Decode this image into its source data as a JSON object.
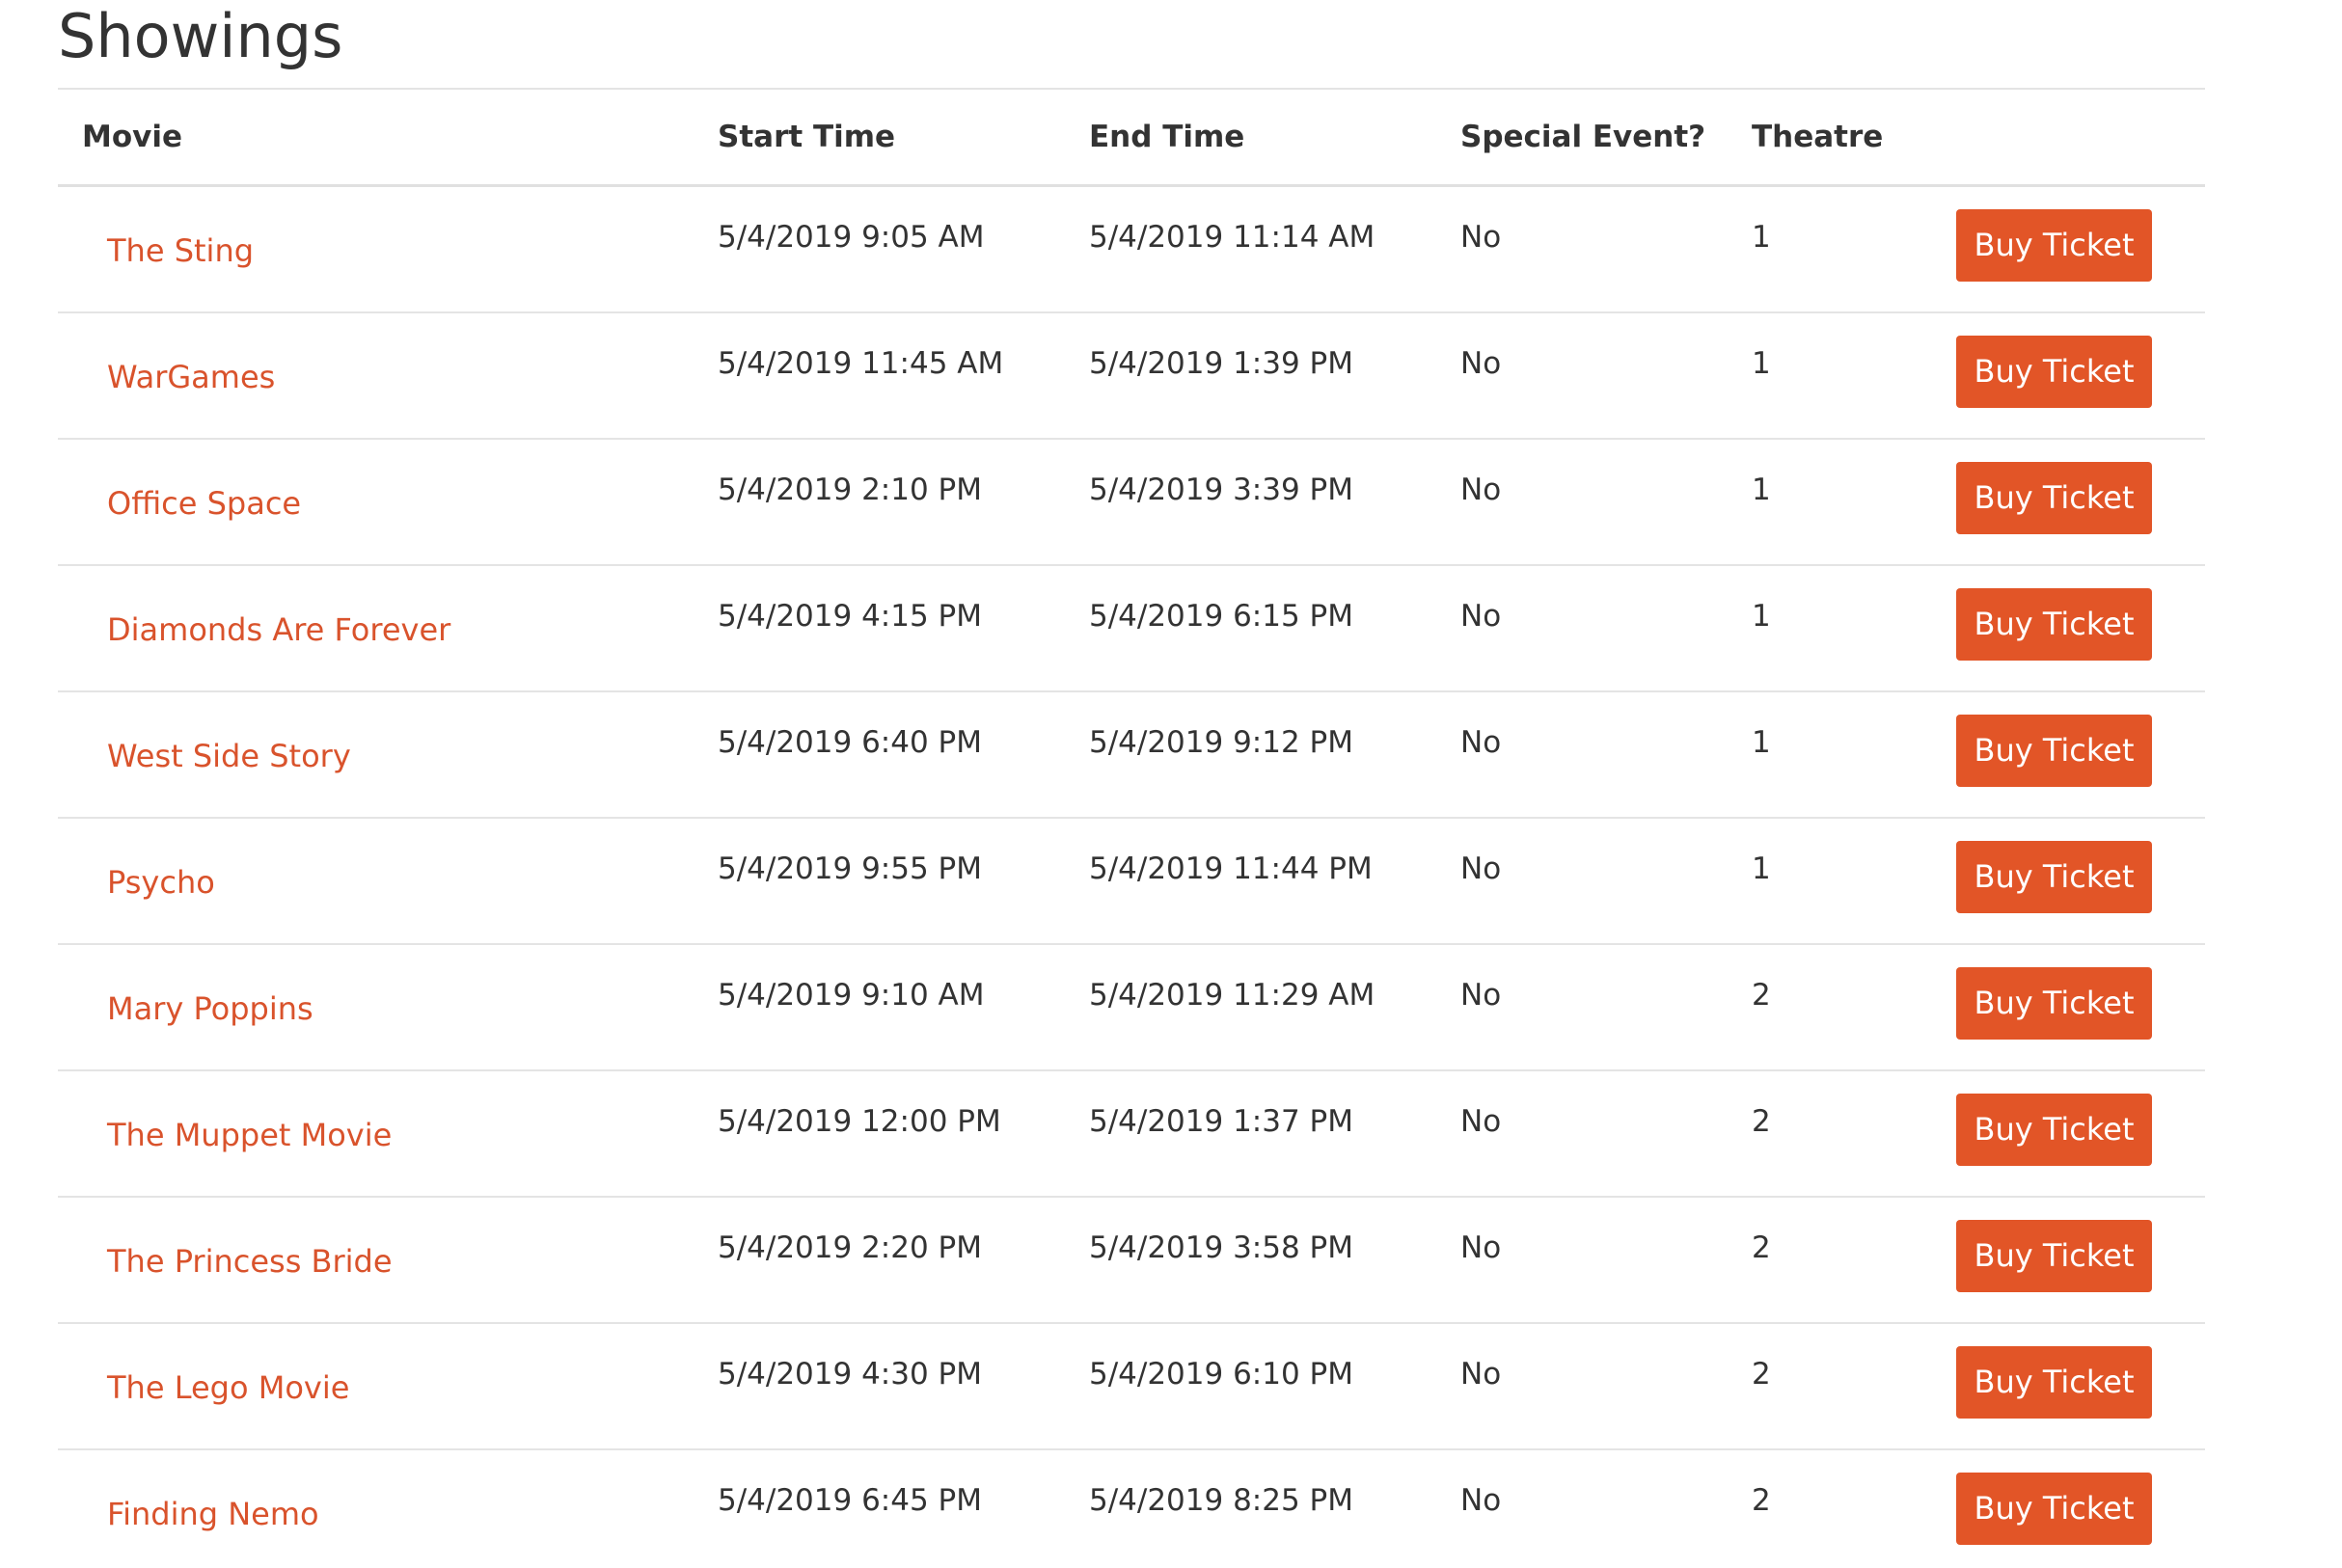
{
  "page": {
    "title": "Showings"
  },
  "colors": {
    "link": "#d9532c",
    "button": "#e25527",
    "text": "#333333",
    "border": "#e4e4e4"
  },
  "table": {
    "headers": {
      "movie": "Movie",
      "start": "Start Time",
      "end": "End Time",
      "special": "Special Event?",
      "theatre": "Theatre"
    },
    "rows": [
      {
        "movie": "The Sting",
        "start": "5/4/2019 9:05 AM",
        "end": "5/4/2019 11:14 AM",
        "special": "No",
        "theatre": "1",
        "button": "Buy Ticket"
      },
      {
        "movie": "WarGames",
        "start": "5/4/2019 11:45 AM",
        "end": "5/4/2019 1:39 PM",
        "special": "No",
        "theatre": "1",
        "button": "Buy Ticket"
      },
      {
        "movie": "Office Space",
        "start": "5/4/2019 2:10 PM",
        "end": "5/4/2019 3:39 PM",
        "special": "No",
        "theatre": "1",
        "button": "Buy Ticket"
      },
      {
        "movie": "Diamonds Are Forever",
        "start": "5/4/2019 4:15 PM",
        "end": "5/4/2019 6:15 PM",
        "special": "No",
        "theatre": "1",
        "button": "Buy Ticket"
      },
      {
        "movie": "West Side Story",
        "start": "5/4/2019 6:40 PM",
        "end": "5/4/2019 9:12 PM",
        "special": "No",
        "theatre": "1",
        "button": "Buy Ticket"
      },
      {
        "movie": "Psycho",
        "start": "5/4/2019 9:55 PM",
        "end": "5/4/2019 11:44 PM",
        "special": "No",
        "theatre": "1",
        "button": "Buy Ticket"
      },
      {
        "movie": "Mary Poppins",
        "start": "5/4/2019 9:10 AM",
        "end": "5/4/2019 11:29 AM",
        "special": "No",
        "theatre": "2",
        "button": "Buy Ticket"
      },
      {
        "movie": "The Muppet Movie",
        "start": "5/4/2019 12:00 PM",
        "end": "5/4/2019 1:37 PM",
        "special": "No",
        "theatre": "2",
        "button": "Buy Ticket"
      },
      {
        "movie": "The Princess Bride",
        "start": "5/4/2019 2:20 PM",
        "end": "5/4/2019 3:58 PM",
        "special": "No",
        "theatre": "2",
        "button": "Buy Ticket"
      },
      {
        "movie": "The Lego Movie",
        "start": "5/4/2019 4:30 PM",
        "end": "5/4/2019 6:10 PM",
        "special": "No",
        "theatre": "2",
        "button": "Buy Ticket"
      },
      {
        "movie": "Finding Nemo",
        "start": "5/4/2019 6:45 PM",
        "end": "5/4/2019 8:25 PM",
        "special": "No",
        "theatre": "2",
        "button": "Buy Ticket"
      }
    ]
  }
}
